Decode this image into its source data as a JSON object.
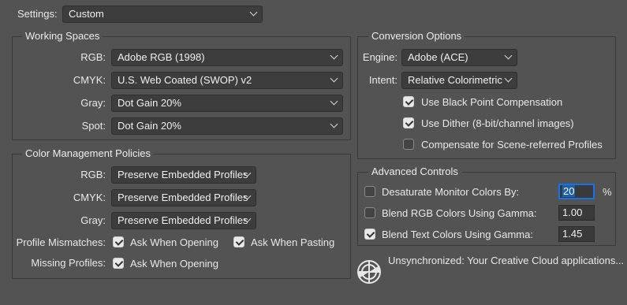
{
  "settings": {
    "label": "Settings:",
    "value": "Custom"
  },
  "working_spaces": {
    "title": "Working Spaces",
    "rgb": {
      "label": "RGB:",
      "value": "Adobe RGB (1998)"
    },
    "cmyk": {
      "label": "CMYK:",
      "value": "U.S. Web Coated (SWOP) v2"
    },
    "gray": {
      "label": "Gray:",
      "value": "Dot Gain 20%"
    },
    "spot": {
      "label": "Spot:",
      "value": "Dot Gain 20%"
    }
  },
  "policies": {
    "title": "Color Management Policies",
    "rgb": {
      "label": "RGB:",
      "value": "Preserve Embedded Profiles"
    },
    "cmyk": {
      "label": "CMYK:",
      "value": "Preserve Embedded Profiles"
    },
    "gray": {
      "label": "Gray:",
      "value": "Preserve Embedded Profiles"
    },
    "mismatches_label": "Profile Mismatches:",
    "ask_opening": "Ask When Opening",
    "ask_pasting": "Ask When Pasting",
    "missing_label": "Missing Profiles:",
    "missing_ask_opening": "Ask When Opening"
  },
  "conversion": {
    "title": "Conversion Options",
    "engine": {
      "label": "Engine:",
      "value": "Adobe (ACE)"
    },
    "intent": {
      "label": "Intent:",
      "value": "Relative Colorimetric"
    },
    "black_point": "Use Black Point Compensation",
    "dither": "Use Dither (8-bit/channel images)",
    "scene_referred": "Compensate for Scene-referred Profiles"
  },
  "advanced": {
    "title": "Advanced Controls",
    "desaturate": {
      "label": "Desaturate Monitor Colors By:",
      "value": "20",
      "unit": "%"
    },
    "blend_rgb": {
      "label": "Blend RGB Colors Using Gamma:",
      "value": "1.00"
    },
    "blend_text": {
      "label": "Blend Text Colors Using Gamma:",
      "value": "1.45"
    }
  },
  "sync_status": "Unsynchronized: Your Creative Cloud applications...",
  "icons": {
    "sync": "sync-globe-icon",
    "chevron": "chevron-down-icon",
    "checkmark": "checkmark-icon"
  },
  "colors": {
    "background": "#535353",
    "focus": "#1473e6",
    "field": "#3d3d3d"
  }
}
